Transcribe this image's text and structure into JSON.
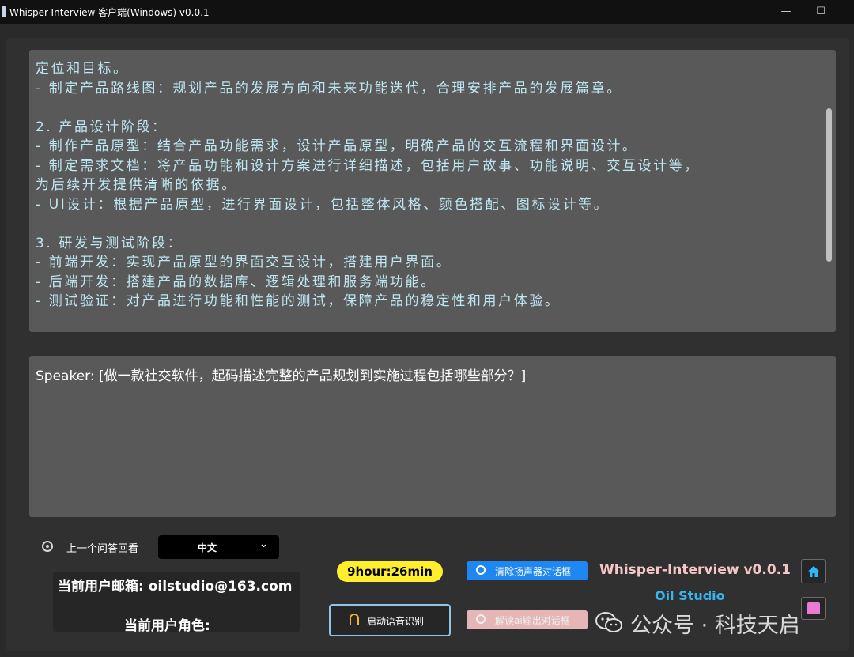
{
  "window": {
    "title": "Whisper-Interview 客户端(Windows) v0.0.1",
    "minimize": "—",
    "maximize": "☐"
  },
  "answer": {
    "lines": [
      "定位和目标。",
      "  - 制定产品路线图：规划产品的发展方向和未来功能迭代，合理安排产品的发展篇章。",
      "",
      " 2. 产品设计阶段：",
      "  - 制作产品原型：结合产品功能需求，设计产品原型，明确产品的交互流程和界面设计。",
      "  - 制定需求文档：将产品功能和设计方案进行详细描述，包括用户故事、功能说明、交互设计等，",
      "为后续开发提供清晰的依据。",
      "  - UI设计：根据产品原型，进行界面设计，包括整体风格、颜色搭配、图标设计等。",
      "",
      " 3. 研发与测试阶段：",
      "  - 前端开发：实现产品原型的界面交互设计，搭建用户界面。",
      "  - 后端开发：搭建产品的数据库、逻辑处理和服务端功能。",
      "  - 测试验证：对产品进行功能和性能的测试，保障产品的稳定性和用户体验。"
    ]
  },
  "question": {
    "text": "Speaker: [做一款社交软件，起码描述完整的产品规划到实施过程包括哪些部分？]"
  },
  "controls": {
    "previous_label": "上一个问答回看",
    "language_value": "中文",
    "timer": "9hour:26min",
    "voice_button": "启动语音识别",
    "clear_button": "清除扬声器对话框",
    "decode_button": "解读ai输出对话框",
    "user_email_label": "当前用户邮箱: oilstudio@163.com",
    "user_role_label": "当前用户角色:"
  },
  "brand": {
    "title": "Whisper-Interview v0.0.1",
    "studio": "Oil Studio"
  },
  "watermark": {
    "text": "公众号 · 科技天启"
  }
}
